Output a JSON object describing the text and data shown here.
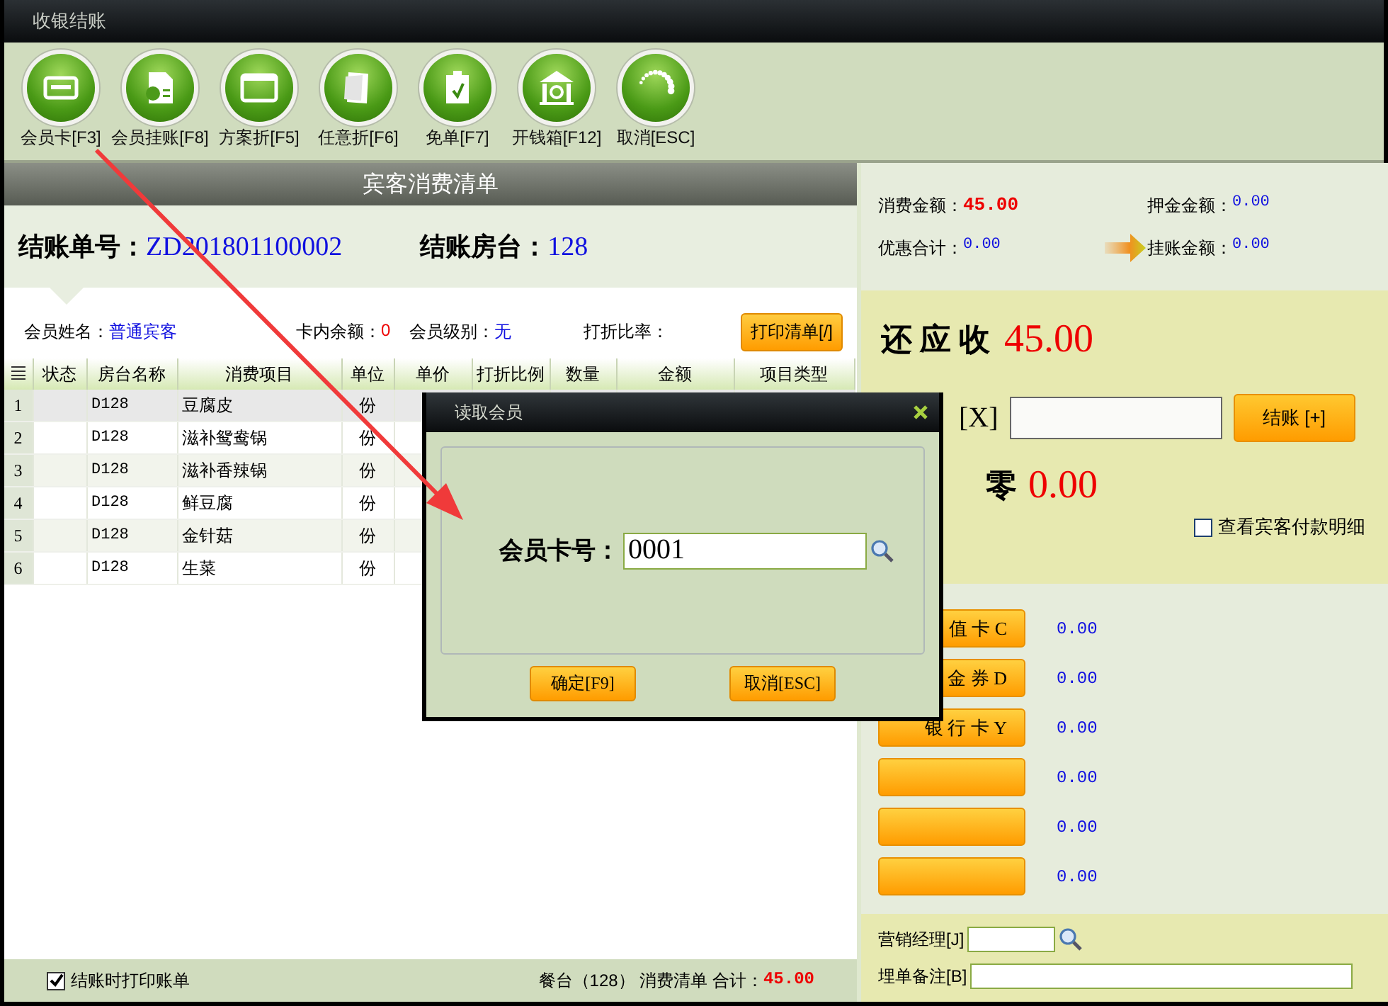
{
  "window": {
    "title": "收银结账"
  },
  "toolbar": [
    {
      "label": "会员卡[F3]",
      "kind": "card"
    },
    {
      "label": "会员挂账[F8]",
      "kind": "document"
    },
    {
      "label": "方案折[F5]",
      "kind": "window"
    },
    {
      "label": "任意折[F6]",
      "kind": "paper"
    },
    {
      "label": "免单[F7]",
      "kind": "clipboard"
    },
    {
      "label": "开钱箱[F12]",
      "kind": "building"
    },
    {
      "label": "取消[ESC]",
      "kind": "ring"
    }
  ],
  "bill_list": {
    "title": "宾客消费清单",
    "bill_no_label": "结账单号：",
    "bill_no": "ZD201801100002",
    "room_label": "结账房台：",
    "room": "128",
    "member_name_label": "会员姓名：",
    "member_name": "普通宾客",
    "card_balance_label": "卡内余额：",
    "card_balance": "0",
    "member_level_label": "会员级别：",
    "member_level": "无",
    "discount_rate_label": "打折比率：",
    "print_button": "打印清单[/]"
  },
  "table": {
    "columns": [
      "状态",
      "房台名称",
      "消费项目",
      "单位",
      "单价",
      "打折比例",
      "数量",
      "金额",
      "项目类型"
    ],
    "rows": [
      {
        "no": "1",
        "room": "D128",
        "item": "豆腐皮",
        "unit": "份",
        "selected": true
      },
      {
        "no": "2",
        "room": "D128",
        "item": "滋补鸳鸯锅",
        "unit": "份",
        "selected": false
      },
      {
        "no": "3",
        "room": "D128",
        "item": "滋补香辣锅",
        "unit": "份",
        "selected": false
      },
      {
        "no": "4",
        "room": "D128",
        "item": "鲜豆腐",
        "unit": "份",
        "selected": false
      },
      {
        "no": "5",
        "room": "D128",
        "item": "金针菇",
        "unit": "份",
        "selected": false
      },
      {
        "no": "6",
        "room": "D128",
        "item": "生菜",
        "unit": "份",
        "selected": false
      }
    ]
  },
  "footer": {
    "print_on_checkout": {
      "label": "结账时打印账单",
      "checked": true
    },
    "summary_label": "餐台（128） 消费清单 合计：",
    "total": "45.00"
  },
  "summary": {
    "consumption_label": "消费金额：",
    "consumption": "45.00",
    "deposit_label": "押金金额：",
    "deposit": "0.00",
    "discount_label": "优惠合计：",
    "discount": "0.00",
    "credit_label": "挂账金额：",
    "credit": "0.00"
  },
  "due": {
    "label": "还 应 收",
    "amount": "45.00"
  },
  "payment": {
    "label": "[X]",
    "checkout_button": "结账 [+]"
  },
  "change": {
    "label": "零",
    "amount": "0.00"
  },
  "show_details": {
    "label": "查看宾客付款明细",
    "checked": false
  },
  "payments": [
    {
      "label": "值 卡 C",
      "amount": "0.00"
    },
    {
      "label": "金 券 D",
      "amount": "0.00"
    },
    {
      "label": "银 行 卡 Y",
      "amount": "0.00"
    },
    {
      "amount": "0.00"
    },
    {
      "amount": "0.00"
    },
    {
      "amount": "0.00"
    }
  ],
  "manager": {
    "label": "营销经理[J]"
  },
  "remark": {
    "label": "埋单备注[B]"
  },
  "dialog": {
    "title": "读取会员",
    "card_label": "会员卡号：",
    "card_value": "0001",
    "ok_button": "确定[F9]",
    "cancel_button": "取消[ESC]"
  }
}
